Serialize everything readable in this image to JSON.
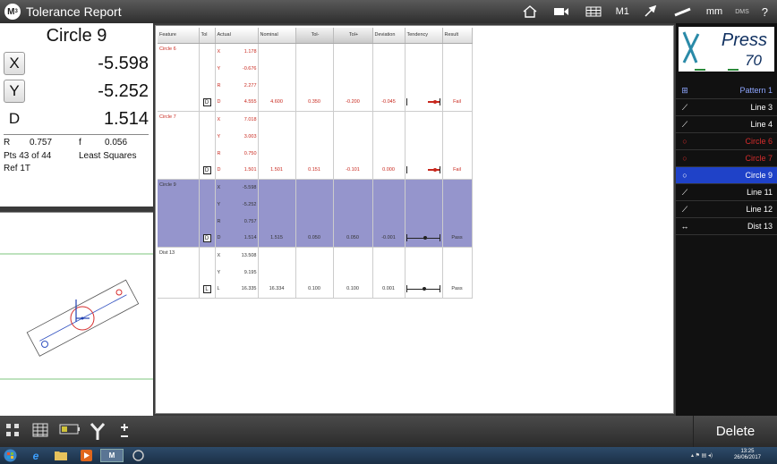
{
  "window": {
    "logo": "M",
    "title": "Tolerance Report",
    "toolbar_text": {
      "m1": "M1",
      "units": "mm",
      "dms": "DMS",
      "help": "?"
    }
  },
  "readout": {
    "feature_name": "Circle 9",
    "rows": [
      {
        "axis": "X",
        "value": "-5.598",
        "button": true
      },
      {
        "axis": "Y",
        "value": "-5.252",
        "button": true
      },
      {
        "axis": "D",
        "value": "1.514",
        "button": false
      }
    ],
    "r_label": "R",
    "r_value": "0.757",
    "f_label": "f",
    "f_value": "0.056",
    "pts": "Pts 43 of 44",
    "fit": "Least Squares",
    "ref": "Ref 1T"
  },
  "table": {
    "headers": [
      "Feature",
      "Tol",
      "Actual",
      "Nominal",
      "Tol-",
      "Tol+",
      "Deviation",
      "Tendency",
      "Result"
    ],
    "groups": [
      {
        "feature": "Circle 6",
        "style": "fail",
        "rows": [
          {
            "axis": "X",
            "actual": "1.178"
          },
          {
            "axis": "Y",
            "actual": "-0.676"
          },
          {
            "axis": "R",
            "actual": "2.277"
          },
          {
            "tol": "D",
            "axis": "D",
            "actual": "4.555",
            "nominal": "4.600",
            "tol_minus": "0.350",
            "tol_plus": "-0.200",
            "deviation": "-0.045",
            "tendency": 0.85,
            "result": "Fail"
          }
        ]
      },
      {
        "feature": "Circle 7",
        "style": "fail",
        "rows": [
          {
            "axis": "X",
            "actual": "7.018"
          },
          {
            "axis": "Y",
            "actual": "3.003"
          },
          {
            "axis": "R",
            "actual": "0.750"
          },
          {
            "tol": "D",
            "axis": "D",
            "actual": "1.501",
            "nominal": "1.501",
            "tol_minus": "0.151",
            "tol_plus": "-0.101",
            "deviation": "0.000",
            "tendency": 0.85,
            "result": "Fail"
          }
        ]
      },
      {
        "feature": "Circle 9",
        "style": "selected",
        "rows": [
          {
            "axis": "X",
            "actual": "-5.598"
          },
          {
            "axis": "Y",
            "actual": "-5.252"
          },
          {
            "axis": "R",
            "actual": "0.757"
          },
          {
            "tol": "D",
            "axis": "D",
            "actual": "1.514",
            "nominal": "1.515",
            "tol_minus": "0.050",
            "tol_plus": "0.050",
            "deviation": "-0.001",
            "tendency": 0.55,
            "result": "Pass"
          }
        ]
      },
      {
        "feature": "Dist 13",
        "style": "normal",
        "rows": [
          {
            "axis": "X",
            "actual": "13.508"
          },
          {
            "axis": "Y",
            "actual": "9.195"
          },
          {
            "tol": "L",
            "axis": "L",
            "actual": "16.335",
            "nominal": "16.334",
            "tol_minus": "0.100",
            "tol_plus": "0.100",
            "deviation": "0.001",
            "tendency": 0.52,
            "result": "Pass"
          }
        ]
      }
    ]
  },
  "feature_list": {
    "brand": "Press",
    "brand_num": "70",
    "items": [
      {
        "icon": "pattern-icon",
        "glyph": "⊞",
        "name": "Pattern 1",
        "state": "first"
      },
      {
        "icon": "line-icon",
        "glyph": "⟋",
        "name": "Line 3",
        "state": "normal"
      },
      {
        "icon": "line-icon",
        "glyph": "⟋",
        "name": "Line 4",
        "state": "normal"
      },
      {
        "icon": "circle-icon",
        "glyph": "○",
        "name": "Circle 6",
        "state": "red"
      },
      {
        "icon": "circle-icon",
        "glyph": "○",
        "name": "Circle 7",
        "state": "red"
      },
      {
        "icon": "circle-icon",
        "glyph": "○",
        "name": "Circle 9",
        "state": "active"
      },
      {
        "icon": "line-icon",
        "glyph": "⟋",
        "name": "Line 11",
        "state": "normal"
      },
      {
        "icon": "line-icon",
        "glyph": "⟋",
        "name": "Line 12",
        "state": "normal"
      },
      {
        "icon": "distance-icon",
        "glyph": "↔",
        "name": "Dist 13",
        "state": "normal"
      }
    ]
  },
  "bottom": {
    "delete_label": "Delete"
  },
  "taskbar": {
    "time": "13:25",
    "date": "26/06/2017"
  },
  "colors": {
    "fail": "#c8281e",
    "selected_row": "#9595cc",
    "active_item": "#1f42c8",
    "red_item": "#d62c2c"
  }
}
